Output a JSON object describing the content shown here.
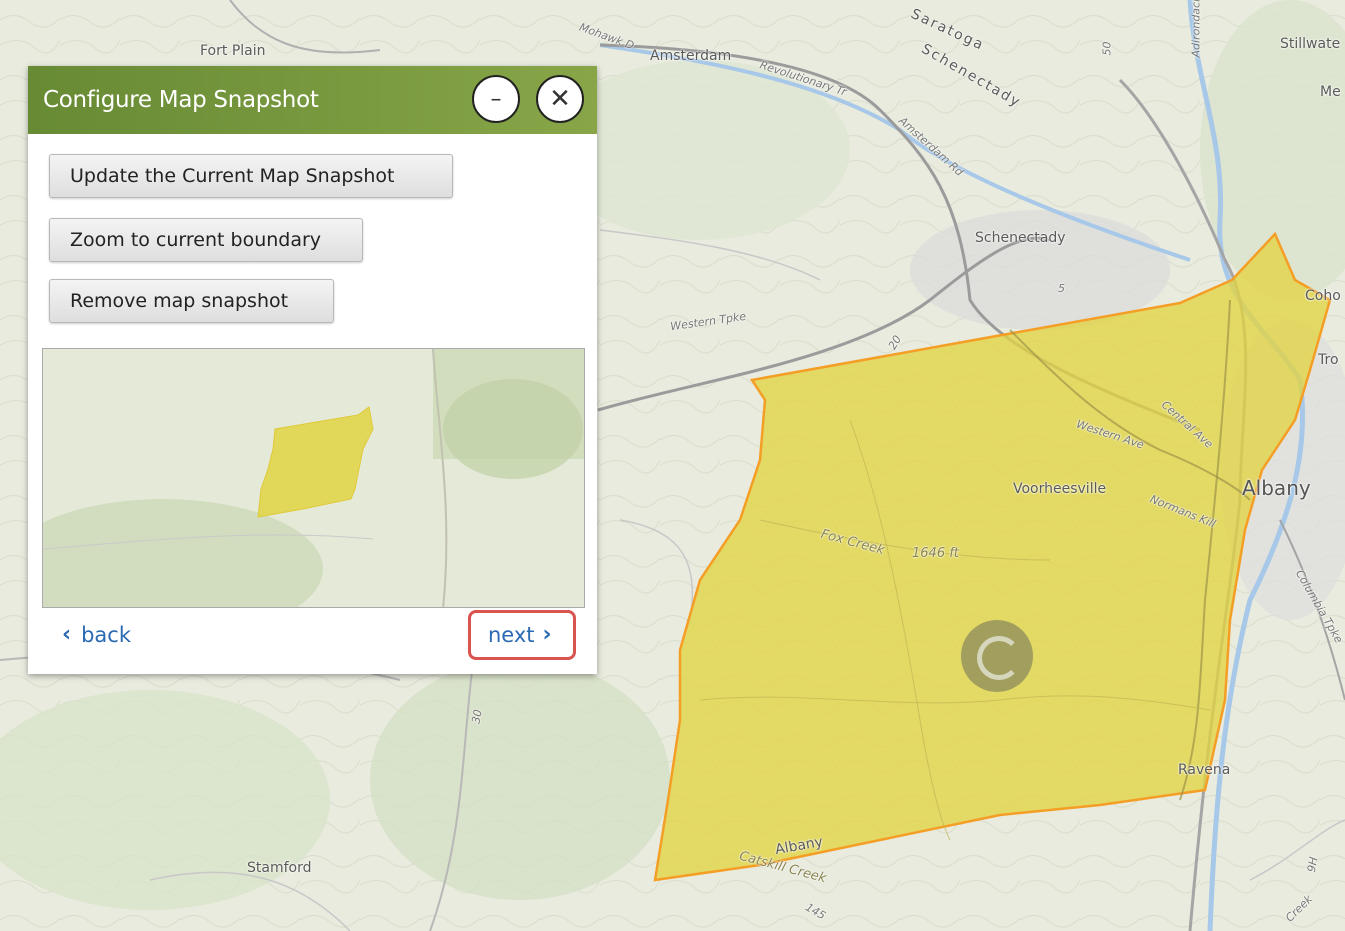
{
  "panel": {
    "title": "Configure Map Snapshot",
    "minimize_icon": "minus-icon",
    "close_icon": "close-icon",
    "buttons": {
      "update": "Update the Current Map Snapshot",
      "zoom": "Zoom to current boundary",
      "remove": "Remove map snapshot"
    },
    "back_label": "back",
    "next_label": "next"
  },
  "map": {
    "places": {
      "fort_plain": "Fort Plain",
      "amsterdam": "Amsterdam",
      "saratoga": "Saratoga",
      "schenectady_county": "Schenectady",
      "schenectady": "Schenectady",
      "stillwater": "Stillwate",
      "me": "Me",
      "coho": "Coho",
      "tro": "Tro",
      "albany": "Albany",
      "voorheesville": "Voorheesville",
      "ravena": "Ravena",
      "stamford": "Stamford",
      "albany_county": "Albany"
    },
    "roads": {
      "mohawk": "Mohawk D",
      "revolutionary": "Revolutionary Tr",
      "amsterdam_rd": "Amsterdam Rd",
      "western_tpke": "Western Tpke",
      "western_ave": "Western Ave",
      "central_ave": "Central Ave",
      "normans_kill": "Normans Kill",
      "columbia_tpke": "Columbia Tpke",
      "adirondack": "Adirondack",
      "catskill_creek": "Catskill Creek",
      "fox_creek": "Fox Creek",
      "elevation": "1646 ft",
      "r50": "50",
      "r5": "5",
      "r20": "20",
      "r30": "30",
      "r145": "145",
      "r9h": "9H",
      "creek_se": "Creek"
    },
    "colors": {
      "boundary_fill": "#e1d443",
      "boundary_stroke": "#f59e26",
      "accent_header": "#6f9038",
      "link": "#2a6ab3",
      "highlight": "#d9534f"
    }
  }
}
